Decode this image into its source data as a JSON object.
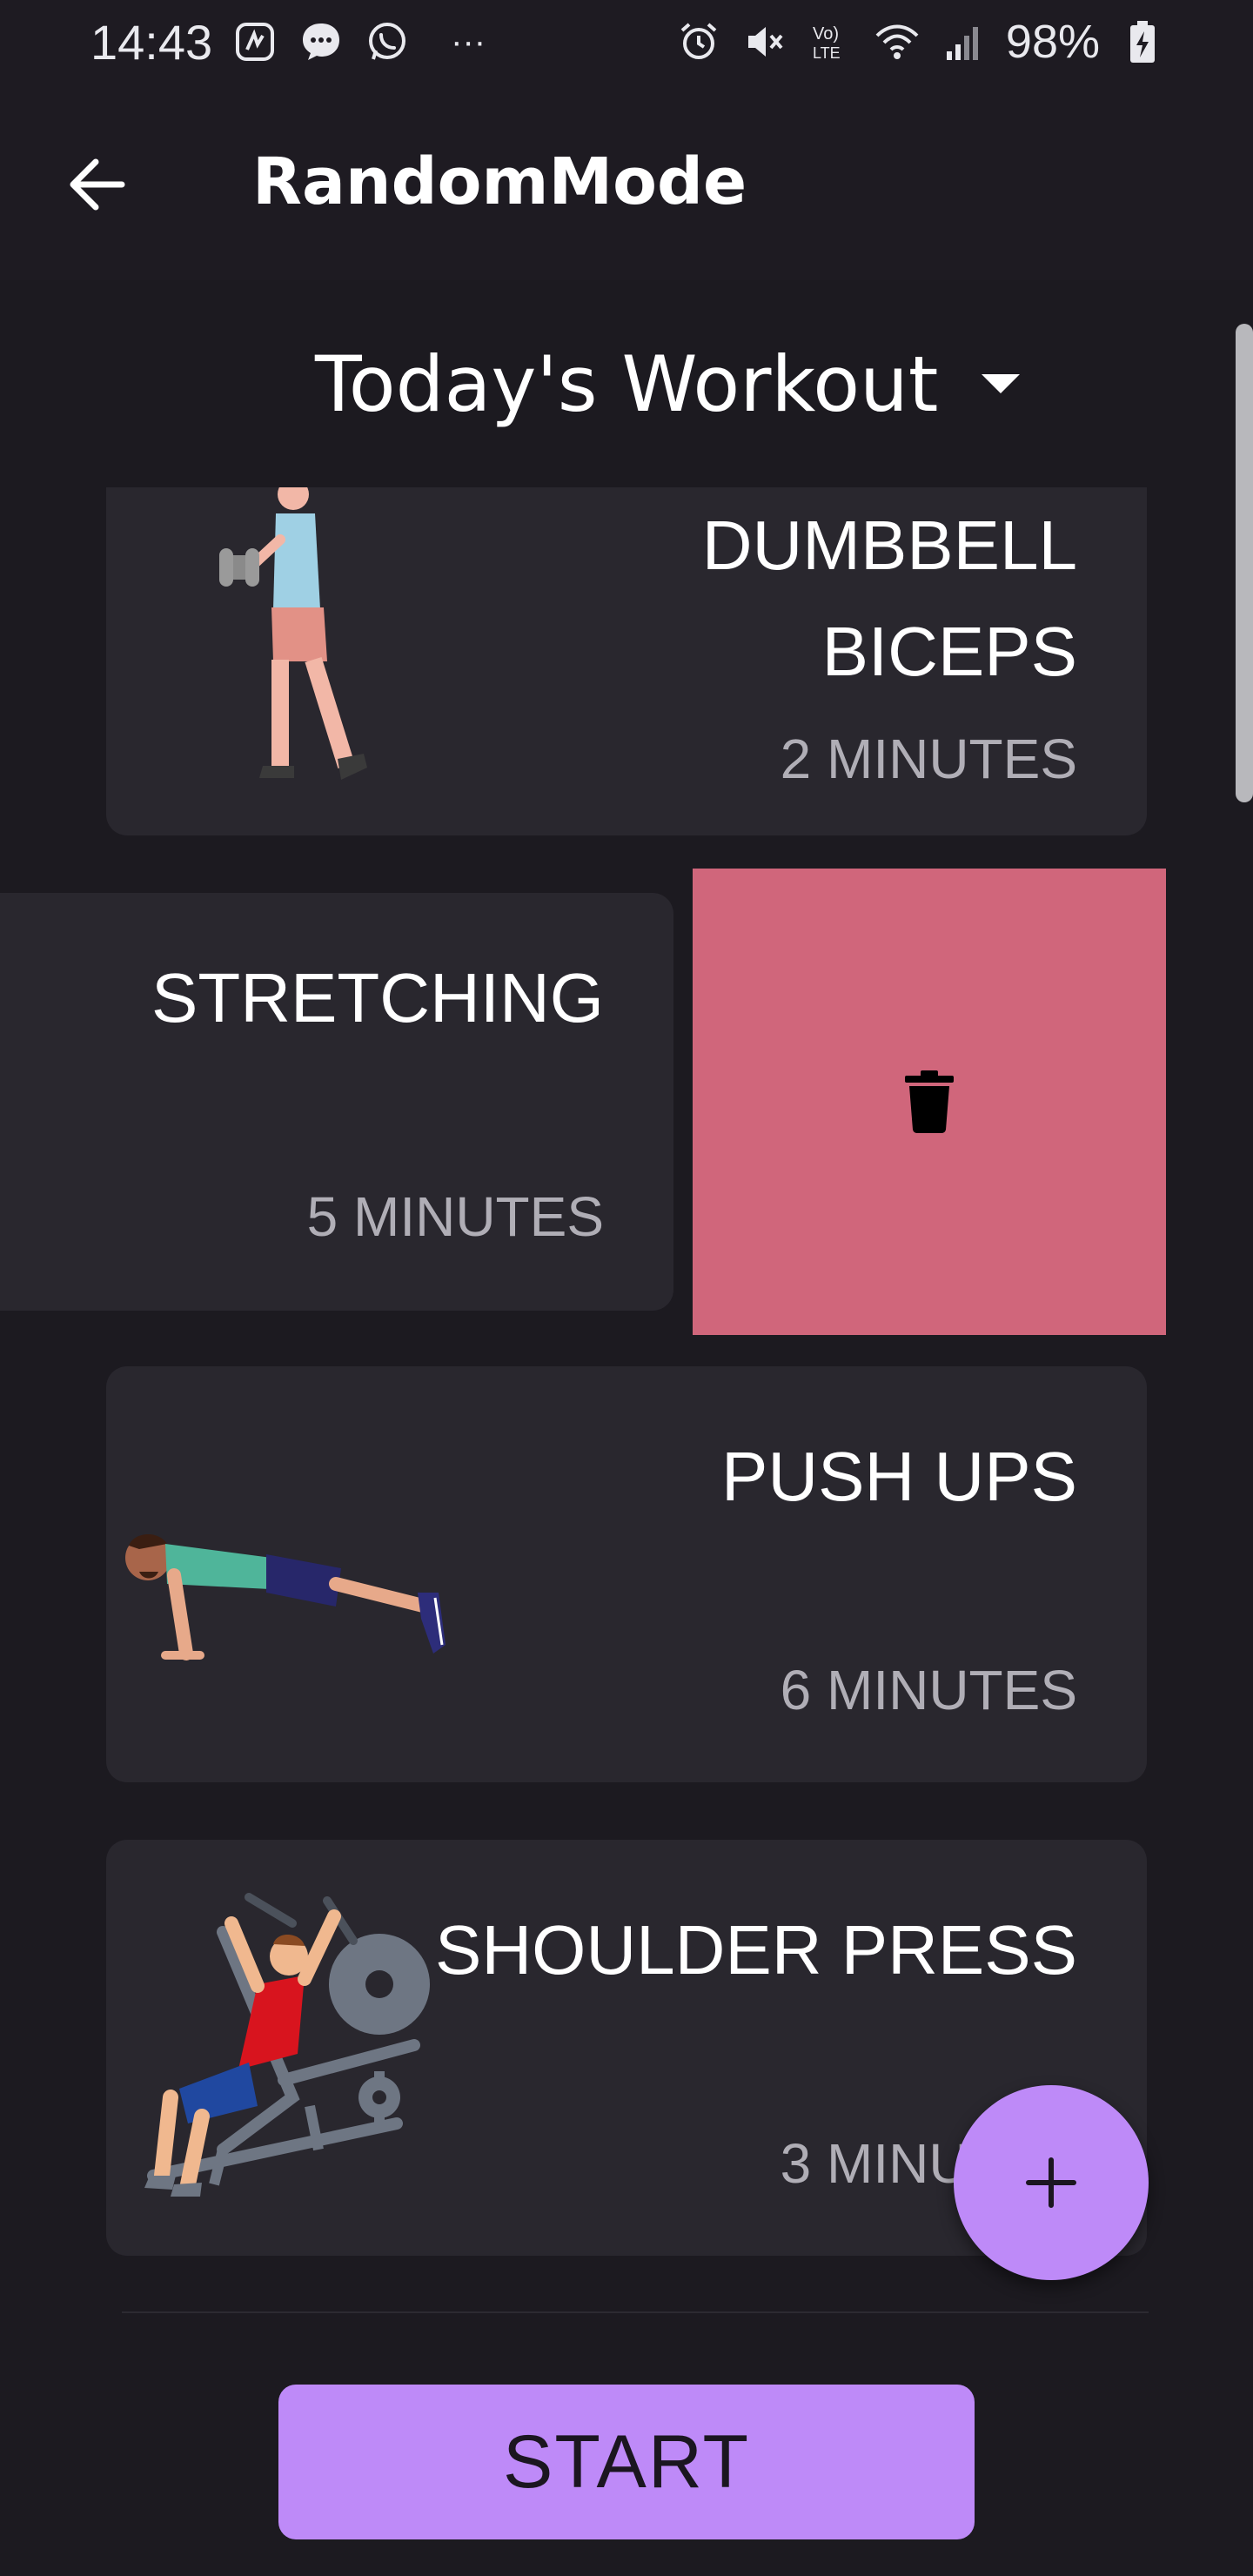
{
  "status_bar": {
    "time": "14:43",
    "more": "···",
    "battery": "98%",
    "left_icons": [
      "jiosaavn-icon",
      "message-icon",
      "whatsapp-icon"
    ],
    "right_icons": [
      "alarm-icon",
      "mute-icon",
      "volte-icon",
      "wifi-icon",
      "signal-icon",
      "battery-icon"
    ]
  },
  "app_bar": {
    "title": "RandomMode",
    "back_icon": "arrow-left-icon"
  },
  "workout_selector": {
    "selected": "Today's Workout"
  },
  "exercises": [
    {
      "name_line1": "DUMBBELL",
      "name_line2": "BICEPS",
      "duration": "2 MINUTES",
      "illustration": "dumbbell-biceps-illustration"
    },
    {
      "name": "STRETCHING",
      "duration": "5 MINUTES",
      "state": "swiped-delete"
    },
    {
      "name": "PUSH UPS",
      "duration": "6 MINUTES",
      "illustration": "push-ups-illustration"
    },
    {
      "name": "SHOULDER PRESS",
      "duration": "3 MINUTES",
      "illustration": "shoulder-press-illustration"
    }
  ],
  "delete_action": {
    "icon": "trash-icon",
    "color": "#d0667b"
  },
  "fab": {
    "label": "+",
    "color": "#be8af8"
  },
  "start_button": {
    "label": "START",
    "color": "#be8af8"
  },
  "colors": {
    "background": "#1e1b22",
    "card": "#29272e",
    "accent": "#be8af8",
    "delete": "#d0667b",
    "secondary_text": "#b0aeb6"
  }
}
